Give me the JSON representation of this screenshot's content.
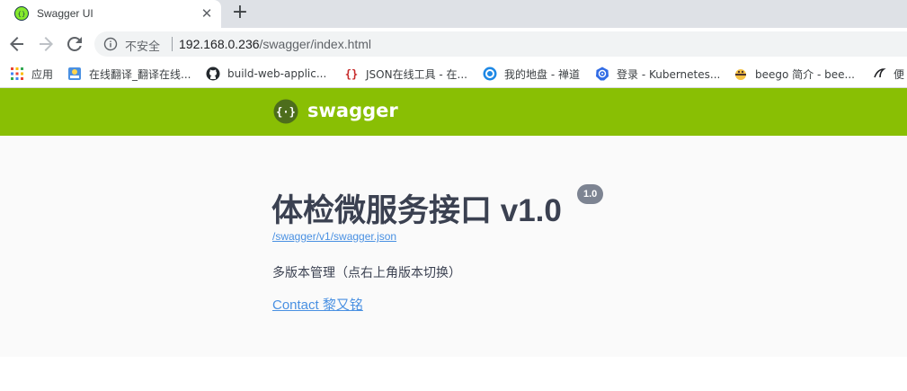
{
  "browser": {
    "tab": {
      "title": "Swagger UI",
      "close_glyph": "✕",
      "favicon": "swagger-icon"
    },
    "new_tab_glyph": "+",
    "toolbar": {
      "back_icon": "back-arrow-icon",
      "forward_icon": "forward-arrow-icon",
      "reload_icon": "reload-icon",
      "security_text": "不安全",
      "url_host": "192.168.0.236",
      "url_path": "/swagger/index.html"
    },
    "bookmarks": [
      {
        "label": "应用",
        "icon": "apps-grid-icon"
      },
      {
        "label": "在线翻译_翻译在线...",
        "icon": "translate-icon"
      },
      {
        "label": "build-web-applic...",
        "icon": "github-icon"
      },
      {
        "label": "JSON在线工具 - 在...",
        "icon": "json-icon"
      },
      {
        "label": "我的地盘 - 禅道",
        "icon": "zentao-icon"
      },
      {
        "label": "登录 - Kubernetes...",
        "icon": "kubernetes-icon"
      },
      {
        "label": "beego 简介 - bee...",
        "icon": "beego-icon"
      },
      {
        "label": "便",
        "icon": "bookmark-icon"
      }
    ]
  },
  "swagger": {
    "brand": "swagger",
    "api_title": "体检微服务接口 v1.0",
    "version": "1.0",
    "spec_url": "/swagger/v1/swagger.json",
    "description": "多版本管理（点右上角版本切换）",
    "contact": "Contact 黎又铭"
  },
  "colors": {
    "topbar": "#89bf04",
    "link": "#4990e2",
    "title": "#3b4151",
    "badge": "#7d8492"
  }
}
